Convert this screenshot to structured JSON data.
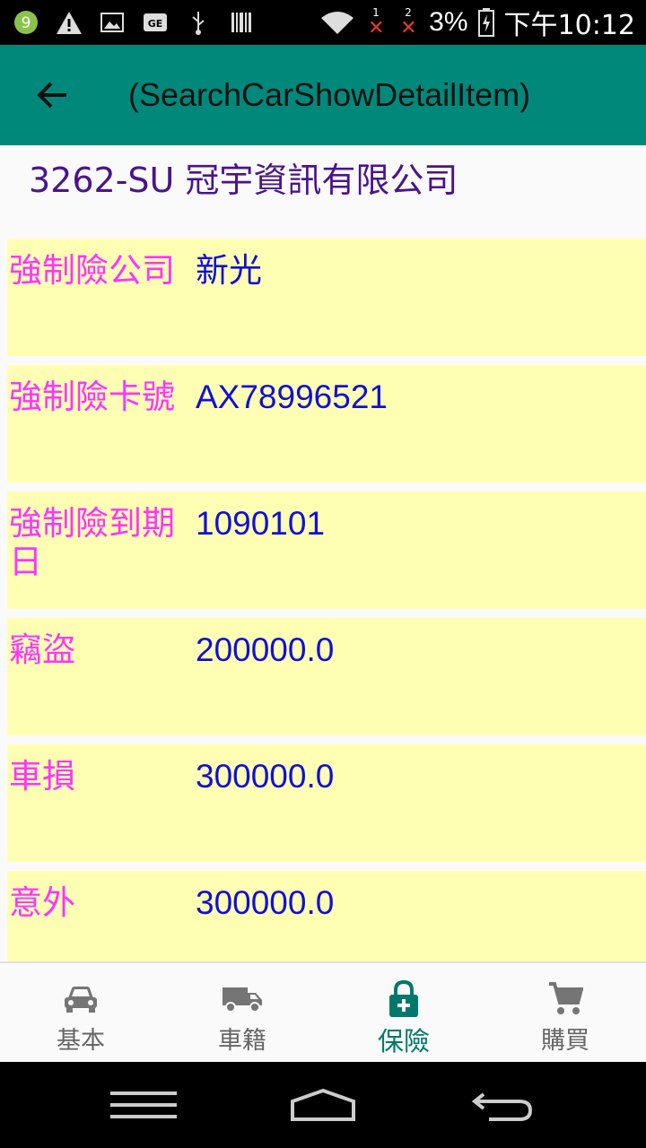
{
  "status_bar": {
    "battery": "3%",
    "time": "下午10:12",
    "sim1": "1",
    "sim2": "2"
  },
  "app_bar": {
    "title": "(SearchCarShowDetailItem)"
  },
  "header": {
    "plate_company": "3262-SU 冠宇資訊有限公司"
  },
  "rows": [
    {
      "label": "強制險公司",
      "value": "新光"
    },
    {
      "label": "強制險卡號",
      "value": "AX78996521"
    },
    {
      "label": "強制險到期日",
      "value": "1090101"
    },
    {
      "label": "竊盜",
      "value": "200000.0"
    },
    {
      "label": "車損",
      "value": "300000.0"
    },
    {
      "label": "意外",
      "value": "300000.0"
    }
  ],
  "bottom_nav": {
    "items": [
      {
        "label": "基本",
        "icon": "car-icon"
      },
      {
        "label": "車籍",
        "icon": "truck-icon"
      },
      {
        "label": "保險",
        "icon": "lock-plus-icon"
      },
      {
        "label": "購買",
        "icon": "cart-icon"
      }
    ],
    "active_index": 2
  },
  "colors": {
    "app_bar": "#00897b",
    "accent": "#00796b",
    "row_bg": "#ffffb3",
    "label": "#ff33ff",
    "value": "#1010d8",
    "header_text": "#4a148c"
  }
}
